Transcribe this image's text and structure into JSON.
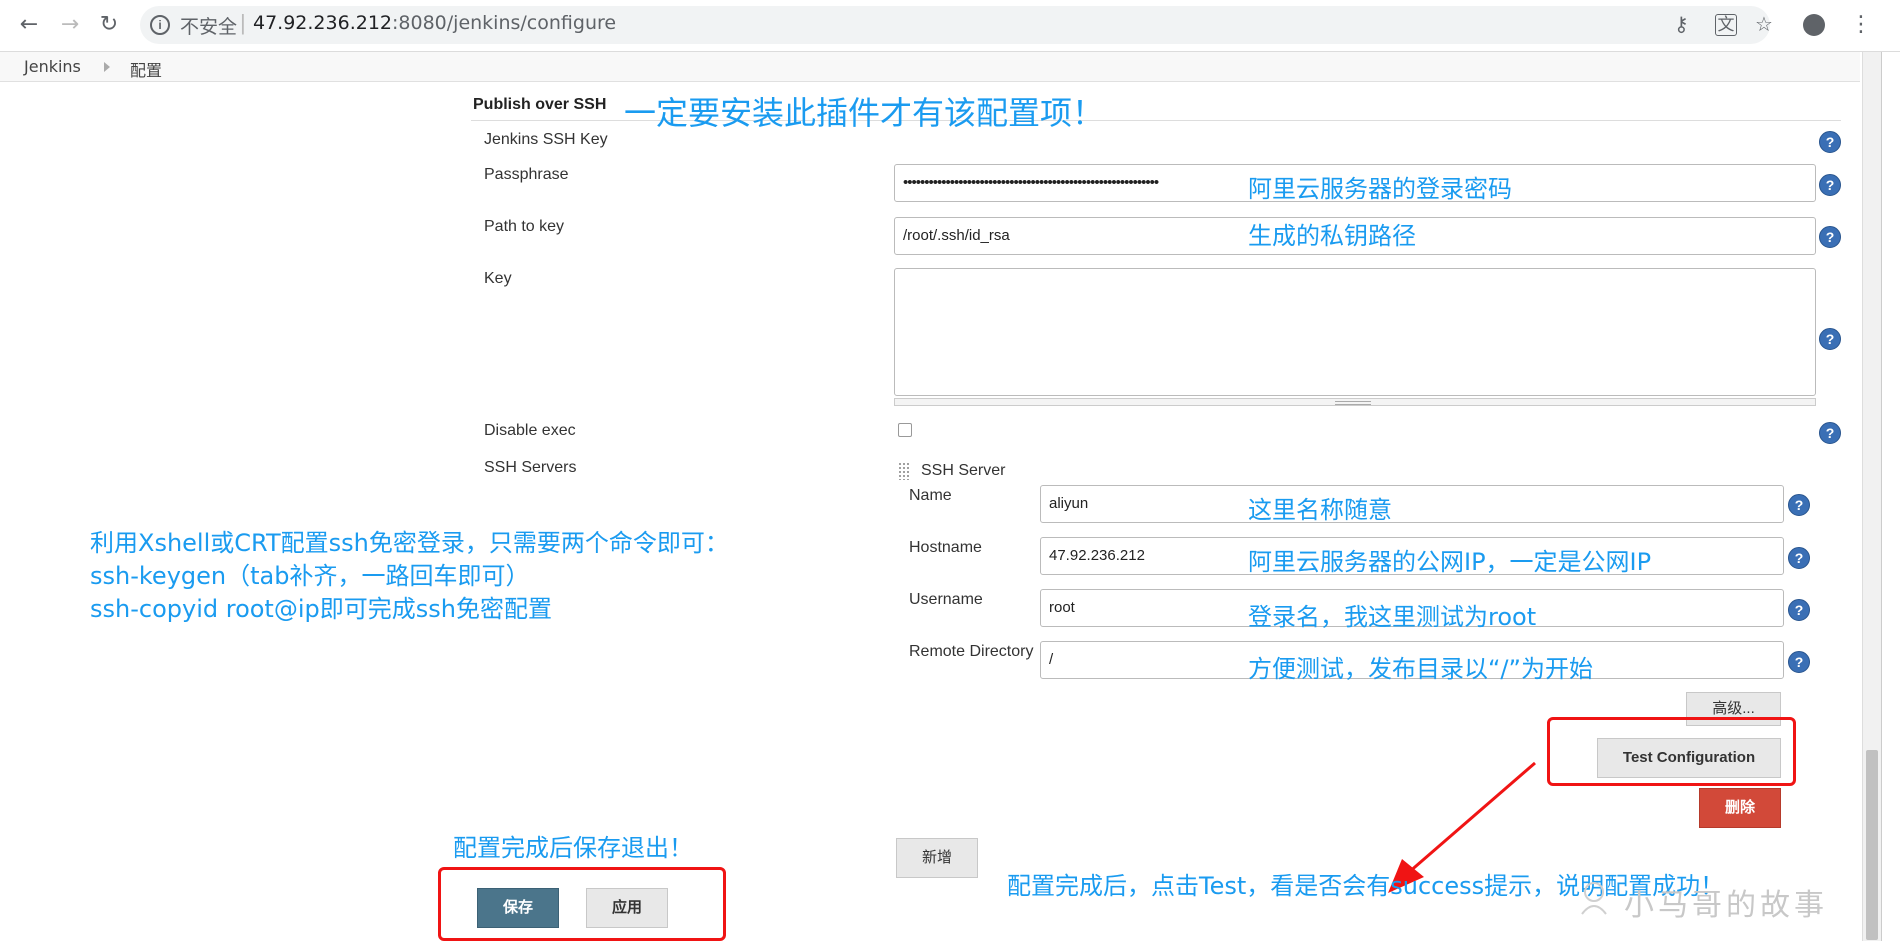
{
  "browser": {
    "insecure_label": "不安全",
    "url_host": "47.92.236.212",
    "url_rest": ":8080/jenkins/configure",
    "back_icon": "←",
    "forward_icon": "→",
    "reload_icon": "↻",
    "key_icon": "⚷",
    "translate_icon": "文",
    "star_icon": "☆",
    "menu_icon": "⋮"
  },
  "breadcrumb": {
    "root": "Jenkins",
    "current": "配置"
  },
  "section": {
    "title": "Publish over SSH"
  },
  "form": {
    "jenkins_ssh_key_label": "Jenkins SSH Key",
    "passphrase_label": "Passphrase",
    "passphrase_value": "••••••••••••••••••••••••••••••••••••••••••••••••••••••••••••",
    "path_to_key_label": "Path to key",
    "path_to_key_value": "/root/.ssh/id_rsa",
    "key_label": "Key",
    "disable_exec_label": "Disable exec",
    "ssh_servers_label": "SSH Servers",
    "ssh_server_header": "SSH Server",
    "name_label": "Name",
    "name_value": "aliyun",
    "hostname_label": "Hostname",
    "hostname_value": "47.92.236.212",
    "username_label": "Username",
    "username_value": "root",
    "remote_dir_label": "Remote Directory",
    "remote_dir_value": "/",
    "help_symbol": "?"
  },
  "buttons": {
    "advanced": "高级...",
    "test_configuration": "Test Configuration",
    "delete": "删除",
    "add": "新增",
    "save": "保存",
    "apply": "应用"
  },
  "annotations": {
    "plugin_note": "一定要安装此插件才有该配置项！",
    "passphrase_note": "阿里云服务器的登录密码",
    "path_note": "生成的私钥路径",
    "name_note": "这里名称随意",
    "hostname_note": "阿里云服务器的公网IP，一定是公网IP",
    "username_note": "登录名，我这里测试为root",
    "remote_dir_note": "方便测试，发布目录以“/”为开始",
    "xshell_line1": "利用Xshell或CRT配置ssh免密登录，只需要两个命令即可：",
    "xshell_line2": "ssh-keygen（tab补齐，一路回车即可）",
    "xshell_line3": "ssh-copyid root@ip即可完成ssh免密配置",
    "save_note": "配置完成后保存退出！",
    "test_note": "配置完成后，点击Test，看是否会有success提示，说明配置成功！"
  },
  "watermark": "小马哥的故事",
  "colors": {
    "annotation_blue": "#1a9bf0",
    "highlight_red": "#f01414",
    "save_button": "#4b758b",
    "delete_button": "#d24939",
    "help_icon": "#3a6fb5"
  }
}
